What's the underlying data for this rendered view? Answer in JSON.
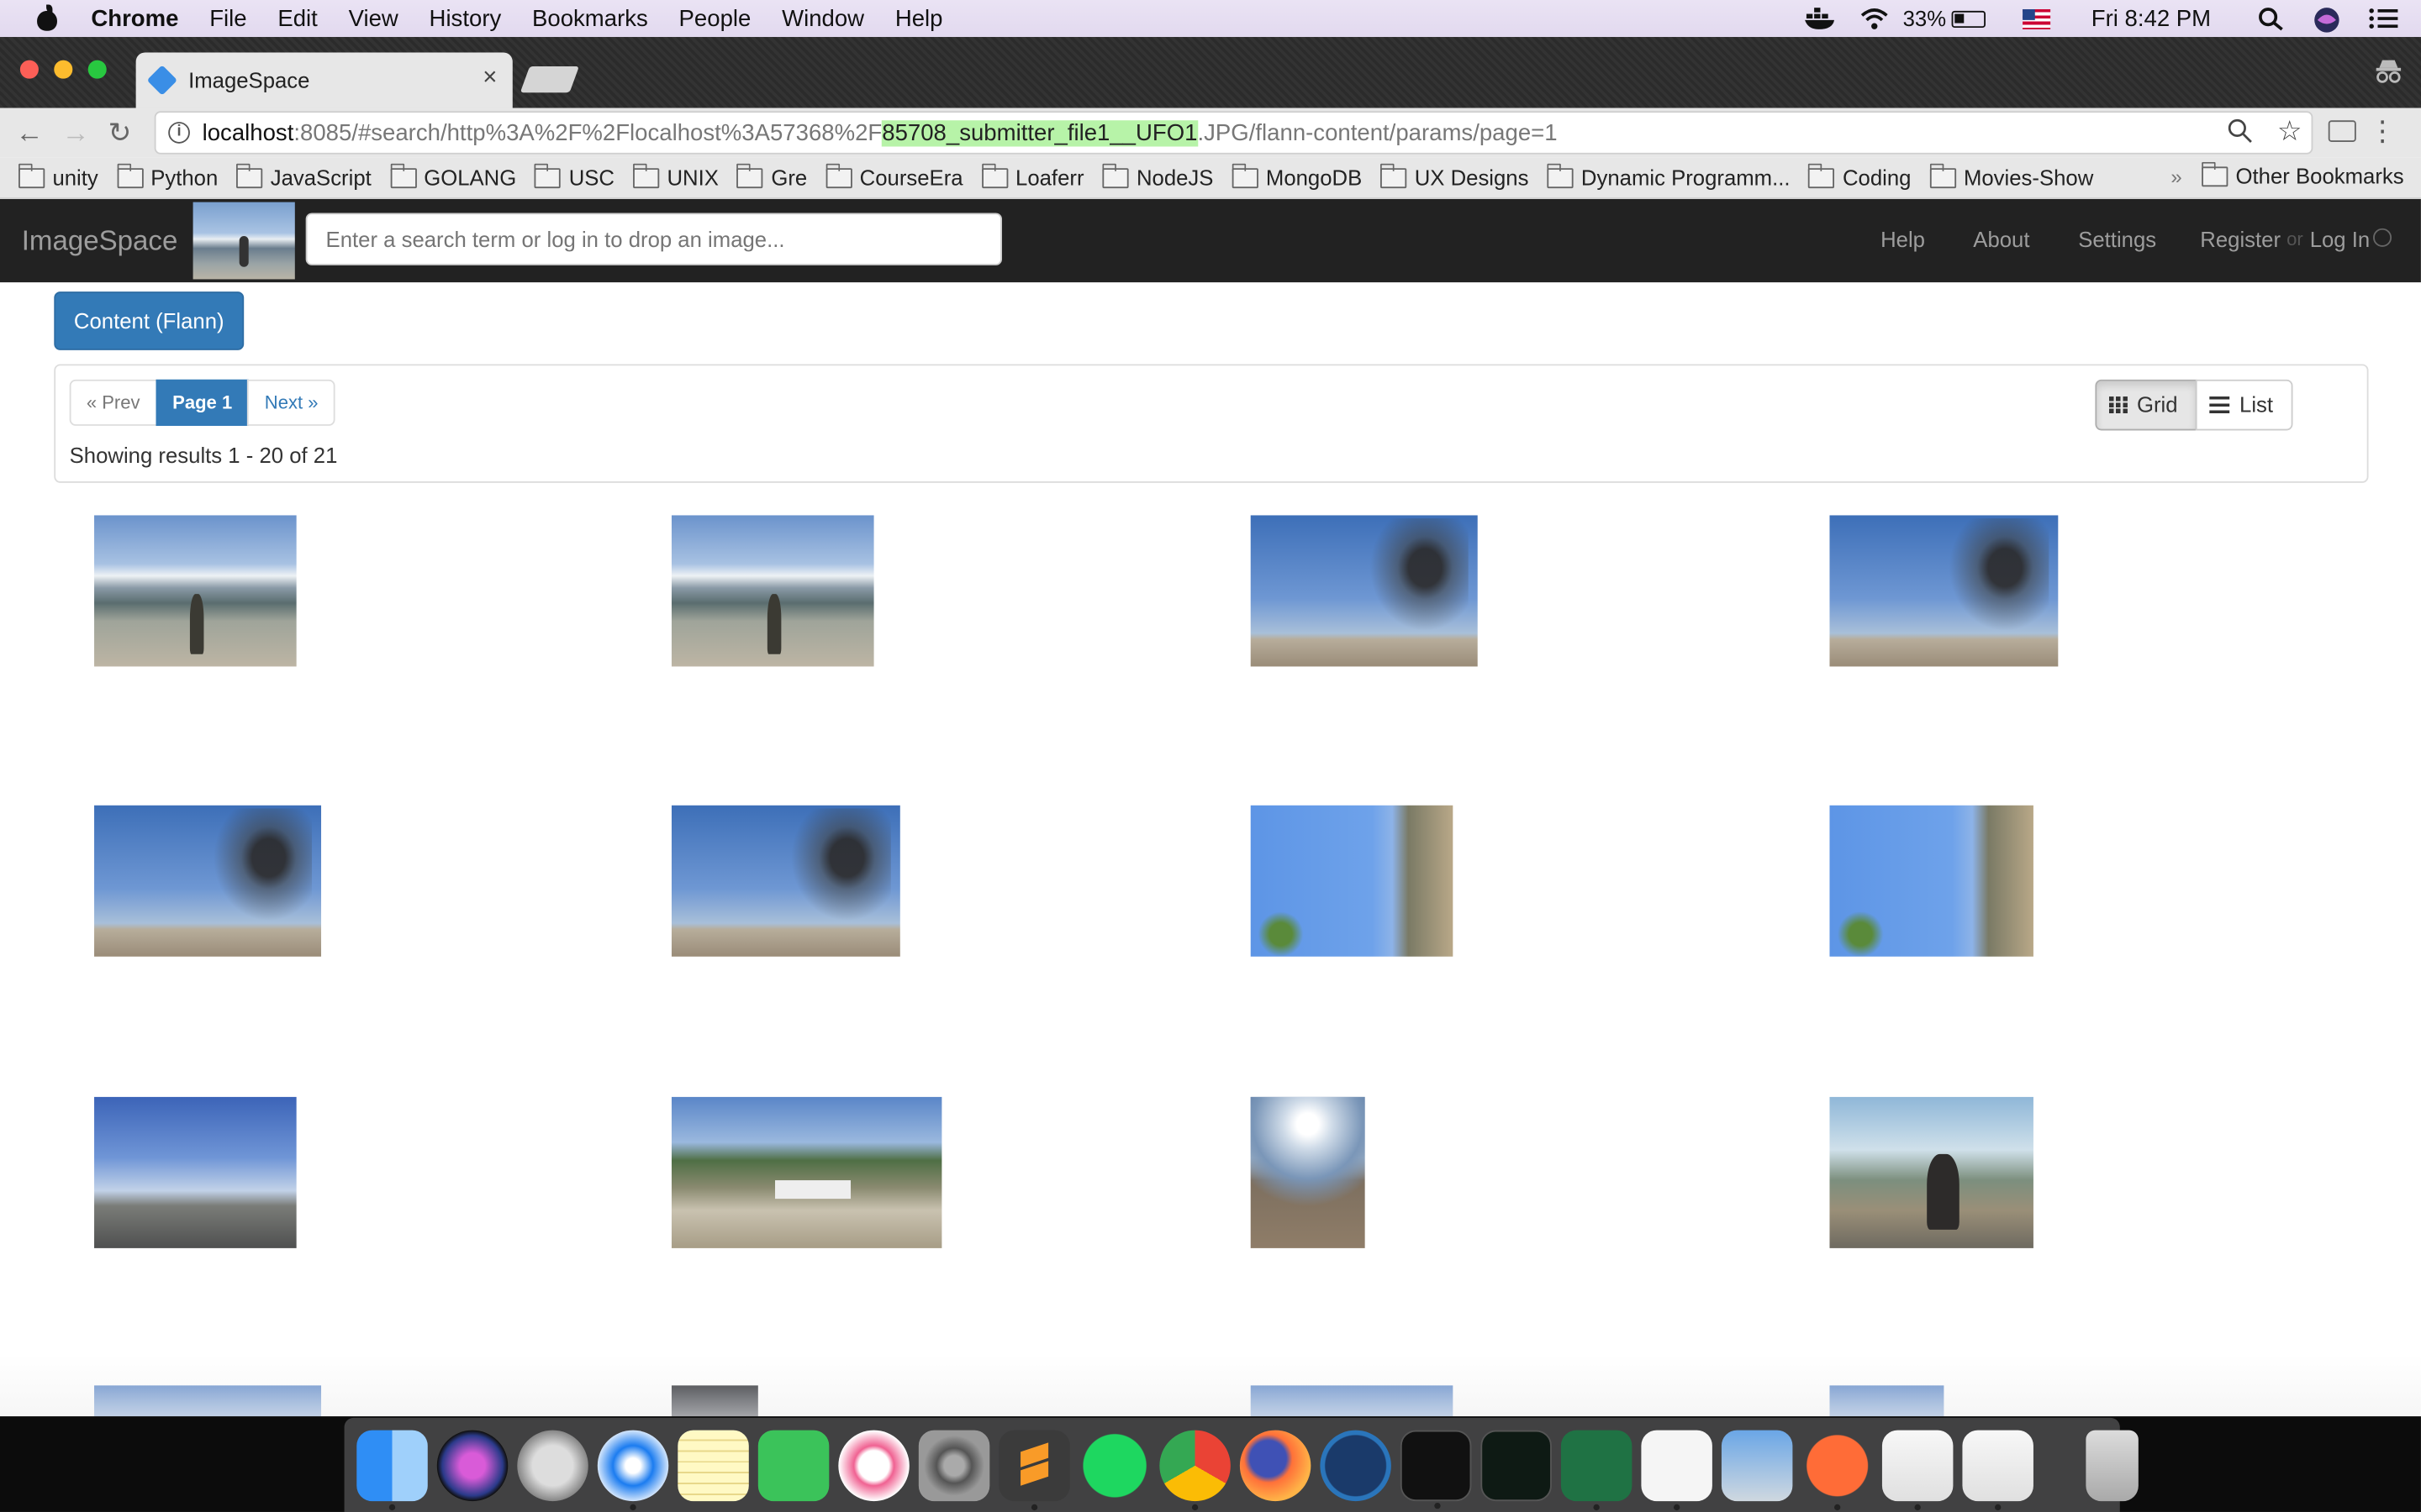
{
  "menubar": {
    "app_name": "Chrome",
    "items": [
      "File",
      "Edit",
      "View",
      "History",
      "Bookmarks",
      "People",
      "Window",
      "Help"
    ],
    "battery": "33%",
    "clock": "Fri 8:42 PM"
  },
  "browser": {
    "tab_title": "ImageSpace",
    "tab_close": "×",
    "url": {
      "host": "localhost",
      "path_before": ":8085/#search/http%3A%2F%2Flocalhost%3A57368%2F",
      "highlight": "85708_submitter_file1__UFO1",
      "path_after": ".JPG/flann-content/params/page=1"
    },
    "bookmarks": [
      "unity",
      "Python",
      "JavaScript",
      "GOLANG",
      "USC",
      "UNIX",
      "Gre",
      "CourseEra",
      "Loaferr",
      "NodeJS",
      "MongoDB",
      "UX Designs",
      "Dynamic Programm...",
      "Coding",
      "Movies-Show"
    ],
    "bookmarks_overflow": "»",
    "other_bookmarks": "Other Bookmarks"
  },
  "site": {
    "brand": "ImageSpace",
    "search_placeholder": "Enter a search term or log in to drop an image...",
    "nav": {
      "help": "Help",
      "about": "About",
      "settings": "Settings",
      "register": "Register",
      "or": "or",
      "login": "Log In"
    },
    "content_button": "Content (Flann)",
    "pager": {
      "prev": "« Prev",
      "current": "Page 1",
      "next": "Next »"
    },
    "showing": "Showing results 1 - 20 of 21",
    "view": {
      "grid": "Grid",
      "list": "List",
      "active": "grid"
    },
    "results": [
      {
        "kind": "mountain-lake-person"
      },
      {
        "kind": "mountain-lake-person"
      },
      {
        "kind": "tree-sky-field"
      },
      {
        "kind": "tree-sky-field"
      },
      {
        "kind": "tree-sky-field"
      },
      {
        "kind": "tree-sky-field"
      },
      {
        "kind": "sky-pole-rotated"
      },
      {
        "kind": "sky-pole-rotated"
      },
      {
        "kind": "highway-sky"
      },
      {
        "kind": "construction-site"
      },
      {
        "kind": "sunset-field"
      },
      {
        "kind": "coastal-path-people"
      },
      {
        "kind": "sky"
      },
      {
        "kind": "phone-screenshot"
      },
      {
        "kind": "sky"
      },
      {
        "kind": "sky"
      }
    ]
  },
  "dock": {
    "apps": [
      "finder-icon",
      "siri-icon",
      "launchpad-icon",
      "safari-icon",
      "notes-icon",
      "facetime-icon",
      "itunes-icon",
      "system-preferences-icon",
      "sublime-text-icon",
      "spotify-icon",
      "chrome-icon",
      "firefox-icon",
      "steam-icon",
      "terminal-icon",
      "activity-monitor-icon",
      "excel-icon",
      "slides-icon",
      "preview-icon",
      "postman-icon",
      "java-icon",
      "java-icon",
      "trash-icon"
    ]
  }
}
